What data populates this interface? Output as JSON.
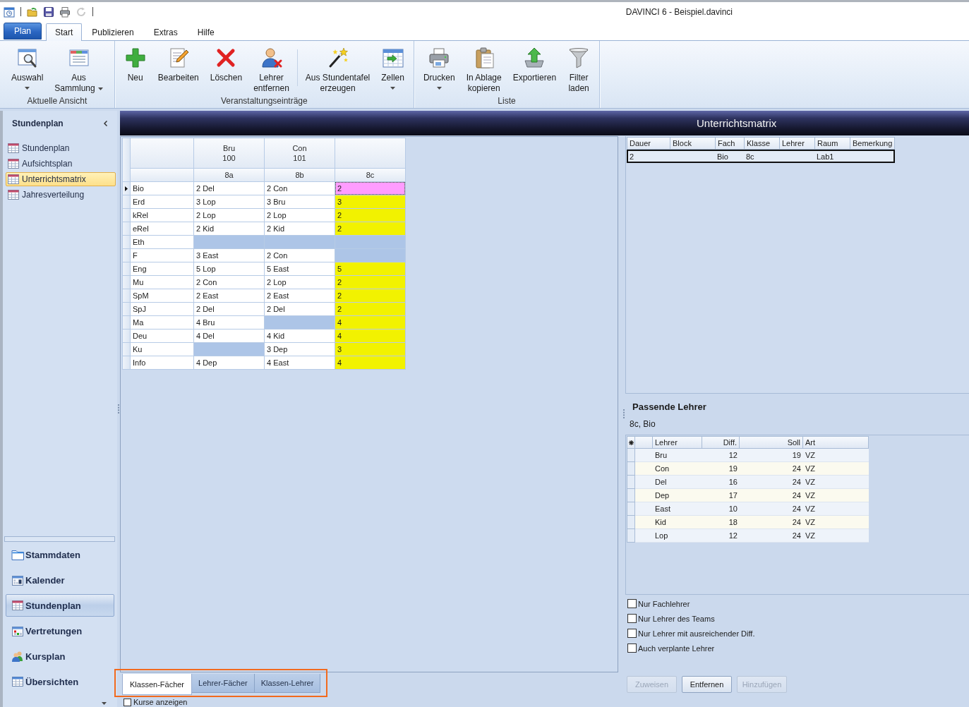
{
  "window": {
    "title": "DAVINCI 6 - Beispiel.davinci"
  },
  "ribbon": {
    "app_button": "Plan",
    "tabs": [
      {
        "label": "Start",
        "selected": true
      },
      {
        "label": "Publizieren",
        "selected": false
      },
      {
        "label": "Extras",
        "selected": false
      },
      {
        "label": "Hilfe",
        "selected": false
      }
    ],
    "groups": [
      {
        "label": "Aktuelle Ansicht",
        "sections": [
          {
            "buttons": [
              {
                "label": "Auswahl",
                "dropdown": true
              },
              {
                "label": "Aus\nSammlung",
                "dropdown": true
              }
            ]
          }
        ]
      },
      {
        "label": "Veranstaltungseinträge",
        "sections": [
          {
            "buttons": [
              {
                "label": "Neu",
                "dropdown": false
              },
              {
                "label": "Bearbeiten",
                "dropdown": false
              },
              {
                "label": "Löschen",
                "dropdown": false
              },
              {
                "label": "Lehrer\nentfernen",
                "dropdown": false
              }
            ]
          },
          {
            "buttons": [
              {
                "label": "Aus Stundentafel\nerzeugen",
                "dropdown": false
              },
              {
                "label": "Zellen",
                "dropdown": true
              }
            ]
          }
        ]
      },
      {
        "label": "Liste",
        "sections": [
          {
            "buttons": [
              {
                "label": "Drucken",
                "dropdown": true
              },
              {
                "label": "In Ablage\nkopieren",
                "dropdown": false
              },
              {
                "label": "Exportieren",
                "dropdown": false
              },
              {
                "label": "Filter\nladen",
                "dropdown": false
              }
            ]
          }
        ]
      }
    ]
  },
  "sidebar": {
    "title": "Stundenplan",
    "items": [
      {
        "label": "Stundenplan",
        "selected": false
      },
      {
        "label": "Aufsichtsplan",
        "selected": false
      },
      {
        "label": "Unterrichtsmatrix",
        "selected": true
      },
      {
        "label": "Jahresverteilung",
        "selected": false
      }
    ],
    "nav": [
      {
        "label": "Stammdaten",
        "selected": false
      },
      {
        "label": "Kalender",
        "selected": false
      },
      {
        "label": "Stundenplan",
        "selected": true
      },
      {
        "label": "Vertretungen",
        "selected": false
      },
      {
        "label": "Kursplan",
        "selected": false
      },
      {
        "label": "Übersichten",
        "selected": false
      }
    ]
  },
  "view": {
    "title": "Unterrichtsmatrix"
  },
  "matrix": {
    "columns": [
      {
        "teacher": "Bru",
        "room": "100",
        "class": "8a"
      },
      {
        "teacher": "Con",
        "room": "101",
        "class": "8b"
      },
      {
        "class": "8c"
      }
    ],
    "rows": [
      {
        "subject": "Bio",
        "current": true,
        "cells": [
          {
            "text": "2 Del",
            "kind": "assigned",
            "selected": false
          },
          {
            "text": "2 Con",
            "kind": "assigned",
            "selected": false
          },
          {
            "text": "2",
            "kind": "open",
            "selected": true
          }
        ]
      },
      {
        "subject": "Erd",
        "current": false,
        "cells": [
          {
            "text": "3 Lop",
            "kind": "assigned",
            "selected": false
          },
          {
            "text": "3 Bru",
            "kind": "assigned",
            "selected": false
          },
          {
            "text": "3",
            "kind": "open",
            "selected": false
          }
        ]
      },
      {
        "subject": "kRel",
        "current": false,
        "cells": [
          {
            "text": "2 Lop",
            "kind": "assigned",
            "selected": false
          },
          {
            "text": "2 Lop",
            "kind": "assigned",
            "selected": false
          },
          {
            "text": "2",
            "kind": "open",
            "selected": false
          }
        ]
      },
      {
        "subject": "eRel",
        "current": false,
        "cells": [
          {
            "text": "2 Kid",
            "kind": "assigned",
            "selected": false
          },
          {
            "text": "2 Kid",
            "kind": "assigned",
            "selected": false
          },
          {
            "text": "2",
            "kind": "open",
            "selected": false
          }
        ]
      },
      {
        "subject": "Eth",
        "current": false,
        "cells": [
          {
            "kind": "blocked",
            "selected": false
          },
          {
            "kind": "blocked",
            "selected": false
          },
          {
            "kind": "blocked",
            "selected": false
          }
        ]
      },
      {
        "subject": "F",
        "current": false,
        "cells": [
          {
            "text": "3 East",
            "kind": "assigned",
            "selected": false
          },
          {
            "text": "2 Con",
            "kind": "assigned",
            "selected": false
          },
          {
            "kind": "blocked",
            "selected": false
          }
        ]
      },
      {
        "subject": "Eng",
        "current": false,
        "cells": [
          {
            "text": "5 Lop",
            "kind": "assigned",
            "selected": false
          },
          {
            "text": "5 East",
            "kind": "assigned",
            "selected": false
          },
          {
            "text": "5",
            "kind": "open",
            "selected": false
          }
        ]
      },
      {
        "subject": "Mu",
        "current": false,
        "cells": [
          {
            "text": "2 Con",
            "kind": "assigned",
            "selected": false
          },
          {
            "text": "2 Lop",
            "kind": "assigned",
            "selected": false
          },
          {
            "text": "2",
            "kind": "open",
            "selected": false
          }
        ]
      },
      {
        "subject": "SpM",
        "current": false,
        "cells": [
          {
            "text": "2 East",
            "kind": "assigned",
            "selected": false
          },
          {
            "text": "2 East",
            "kind": "assigned",
            "selected": false
          },
          {
            "text": "2",
            "kind": "open",
            "selected": false
          }
        ]
      },
      {
        "subject": "SpJ",
        "current": false,
        "cells": [
          {
            "text": "2 Del",
            "kind": "assigned",
            "selected": false
          },
          {
            "text": "2 Del",
            "kind": "assigned",
            "selected": false
          },
          {
            "text": "2",
            "kind": "open",
            "selected": false
          }
        ]
      },
      {
        "subject": "Ma",
        "current": false,
        "cells": [
          {
            "text": "4 Bru",
            "kind": "assigned",
            "selected": false
          },
          {
            "kind": "blocked",
            "selected": false
          },
          {
            "text": "4",
            "kind": "open",
            "selected": false
          }
        ]
      },
      {
        "subject": "Deu",
        "current": false,
        "cells": [
          {
            "text": "4 Del",
            "kind": "assigned",
            "selected": false
          },
          {
            "text": "4 Kid",
            "kind": "assigned",
            "selected": false
          },
          {
            "text": "4",
            "kind": "open",
            "selected": false
          }
        ]
      },
      {
        "subject": "Ku",
        "current": false,
        "cells": [
          {
            "kind": "blocked",
            "selected": false
          },
          {
            "text": "3 Dep",
            "kind": "assigned",
            "selected": false
          },
          {
            "text": "3",
            "kind": "open",
            "selected": false
          }
        ]
      },
      {
        "subject": "Info",
        "current": false,
        "cells": [
          {
            "text": "4 Dep",
            "kind": "assigned",
            "selected": false
          },
          {
            "text": "4 East",
            "kind": "assigned",
            "selected": false
          },
          {
            "text": "4",
            "kind": "open",
            "selected": false
          }
        ]
      }
    ]
  },
  "view_tabs": {
    "highlighted": true,
    "tabs": [
      {
        "label": "Klassen-Fächer",
        "selected": true
      },
      {
        "label": "Lehrer-Fächer",
        "selected": false
      },
      {
        "label": "Klassen-Lehrer",
        "selected": false
      }
    ]
  },
  "show_courses": {
    "label": "Kurse anzeigen",
    "checked": false
  },
  "entries": {
    "columns": [
      "Dauer",
      "Block",
      "Fach",
      "Klasse",
      "Lehrer",
      "Raum",
      "Bemerkung"
    ],
    "rows": [
      {
        "selected": true,
        "cells": [
          "2",
          null,
          "Bio",
          "8c",
          null,
          "Lab1",
          null
        ]
      }
    ]
  },
  "matching_teachers": {
    "title": "Passende Lehrer",
    "context": "8c, Bio",
    "columns": [
      "Lehrer",
      "Diff.",
      "Soll",
      "Art"
    ],
    "rows": [
      {
        "cells": [
          "Bru",
          "12",
          "19",
          "VZ"
        ]
      },
      {
        "cells": [
          "Con",
          "19",
          "24",
          "VZ"
        ]
      },
      {
        "cells": [
          "Del",
          "16",
          "24",
          "VZ"
        ]
      },
      {
        "cells": [
          "Dep",
          "17",
          "24",
          "VZ"
        ]
      },
      {
        "cells": [
          "East",
          "10",
          "24",
          "VZ"
        ]
      },
      {
        "cells": [
          "Kid",
          "18",
          "24",
          "VZ"
        ]
      },
      {
        "cells": [
          "Lop",
          "12",
          "24",
          "VZ"
        ]
      }
    ]
  },
  "filters": [
    {
      "label": "Nur Fachlehrer",
      "checked": false
    },
    {
      "label": "Nur Lehrer des Teams",
      "checked": false
    },
    {
      "label": "Nur Lehrer mit ausreichender Diff.",
      "checked": false
    },
    {
      "label": "Auch verplante Lehrer",
      "checked": false
    }
  ],
  "actions": [
    {
      "label": "Zuweisen",
      "disabled": true
    },
    {
      "label": "Entfernen",
      "disabled": false
    },
    {
      "label": "Hinzufügen",
      "disabled": true
    }
  ]
}
